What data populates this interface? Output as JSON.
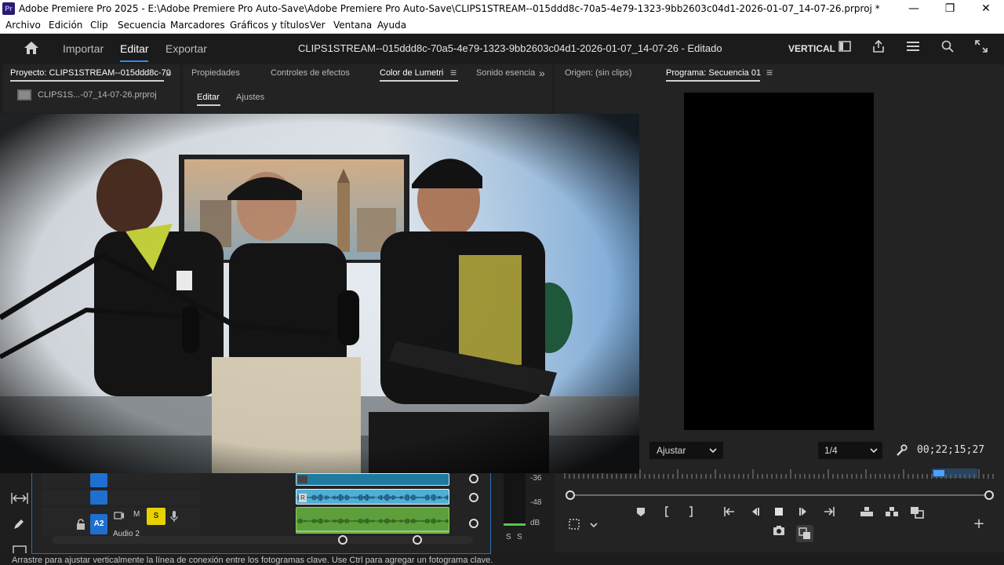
{
  "window": {
    "app_icon": "Pr",
    "title": "Adobe Premiere Pro 2025 - E:\\Adobe Premiere Pro Auto-Save\\Adobe Premiere Pro Auto-Save\\CLIPS1STREAM--015ddd8c-70a5-4e79-1323-9bb2603c04d1-2026-01-07_14-07-26.prproj *",
    "minimize": "—",
    "restore": "❐",
    "close": "✕"
  },
  "menu": [
    "Archivo",
    "Edición",
    "Clip",
    "Secuencia",
    "Marcadores",
    "Gráficos y títulos",
    "Ver",
    "Ventana",
    "Ayuda"
  ],
  "header": {
    "home_icon": "home-icon",
    "nav": [
      "Importar",
      "Editar",
      "Exportar"
    ],
    "active_nav": "Editar",
    "document_title": "CLIPS1STREAM--015ddd8c-70a5-4e79-1323-9bb2603c04d1-2026-01-07_14-07-26 - Editado",
    "workspace": "VERTICAL",
    "accent_color": "#2d8ceb"
  },
  "project_panel": {
    "tab": "Proyecto: CLIPS1STREAM--015ddd8c-70",
    "expand": "»",
    "file": "CLIPS1S...-07_14-07-26.prproj"
  },
  "effects_panel": {
    "tabs": [
      "Propiedades",
      "Controles de efectos",
      "Color de Lumetri",
      "Sonido esencia"
    ],
    "active_tab": "Color de Lumetri",
    "menu_glyph": "≡",
    "expand": "»",
    "subtabs": [
      "Editar",
      "Ajustes"
    ],
    "active_subtab": "Editar"
  },
  "source_monitor": {
    "tab": "Origen: (sin clips)"
  },
  "program_monitor": {
    "tab": "Programa: Secuencia 01",
    "menu_glyph": "≡",
    "fit": "Ajustar",
    "resolution": "1/4",
    "timecode": "00;22;15;27"
  },
  "timeline": {
    "meter_labels": [
      "-36",
      "-48",
      "dB"
    ],
    "meter_solo": [
      "S",
      "S"
    ],
    "track": {
      "name": "A2",
      "mute": "M",
      "solo": "S",
      "label": "Audio 2",
      "clip_marker": "R"
    }
  },
  "status_bar": {
    "text": "Arrastre para ajustar verticalmente la línea de conexión entre los fotogramas clave. Use Ctrl para agregar un fotograma clave."
  }
}
